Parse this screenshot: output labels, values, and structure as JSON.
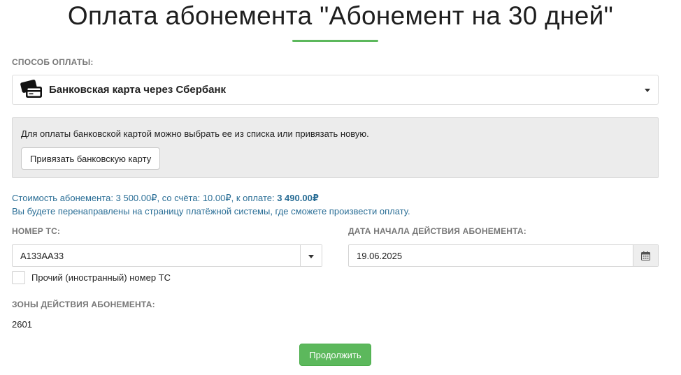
{
  "page": {
    "title": "Оплата абонемента \"Абонемент на 30 дней\""
  },
  "payment_method": {
    "label": "СПОСОБ ОПЛАТЫ:",
    "selected": "Банковская карта через Сбербанк",
    "icon": "credit-cards-icon"
  },
  "info": {
    "text": "Для оплаты банковской картой можно выбрать ее из списка  или привязать новую.",
    "bind_card_label": "Привязать банковскую карту"
  },
  "cost": {
    "prefix": "Стоимость абонемента: 3 500.00₽, со счёта: 10.00₽, к оплате: ",
    "total": "3 490.00₽",
    "redirect_note": "Вы будете перенаправлены на страницу платёжной системы, где сможете произвести оплату."
  },
  "vehicle": {
    "label": "НОМЕР ТС:",
    "value": "А133АА33",
    "foreign_label": "Прочий (иностранный) номер ТС",
    "foreign_checked": false
  },
  "start_date": {
    "label": "ДАТА НАЧАЛА ДЕЙСТВИЯ АБОНЕМЕНТА:",
    "value": "19.06.2025",
    "icon": "calendar-icon"
  },
  "zones": {
    "label": "ЗОНЫ ДЕЙСТВИЯ АБОНЕМЕНТА:",
    "value": "2601"
  },
  "actions": {
    "continue_label": "Продолжить"
  },
  "colors": {
    "accent_green": "#5cb85c",
    "info_blue": "#2a6e96"
  }
}
